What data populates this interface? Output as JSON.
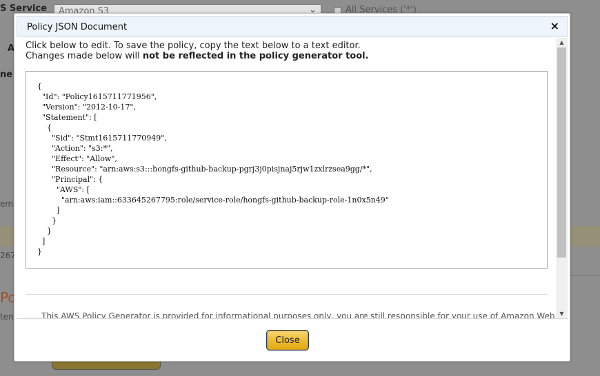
{
  "background": {
    "service_label": "S Service",
    "service_select_value": "Amazon S3",
    "all_services_label": "All Services ('*')",
    "label_a": "A",
    "label_ne": "ne",
    "label_em": "em",
    "label_267": "267",
    "label_pol": "Pol",
    "label_ten": "ten"
  },
  "dialog": {
    "title": "Policy JSON Document",
    "close_icon": "×",
    "intro_line1": "Click below to edit. To save the policy, copy the text below to a text editor.",
    "intro_line2_prefix": "Changes made below will ",
    "intro_line2_bold": "not be reflected in the policy generator tool.",
    "policy_json": "{\n  \"Id\": \"Policy1615711771956\",\n  \"Version\": \"2012-10-17\",\n  \"Statement\": [\n    {\n      \"Sid\": \"Stmt1615711770949\",\n      \"Action\": \"s3:*\",\n      \"Effect\": \"Allow\",\n      \"Resource\": \"arn:aws:s3:::hongfs-github-backup-pgrj3j0pisjnaj5rjw1zxlrzsea9gg/*\",\n      \"Principal\": {\n        \"AWS\": [\n          \"arn:aws:iam::633645267795:role/service-role/hongfs-github-backup-role-1n0x5n49\"\n        ]\n      }\n    }\n  ]\n}",
    "disclaimer": "This AWS Policy Generator is provided for informational purposes only, you are still responsible for your use of Amazon Web Services",
    "close_button_label": "Close"
  },
  "icons": {
    "close": "close-icon",
    "scroll_up": "scroll-up-icon",
    "scroll_down": "scroll-down-icon",
    "select_chevron": "chevron-down-icon"
  },
  "colors": {
    "title_bar": "#eef4fc",
    "close_button": "#eeb930",
    "overlay": "#8e8e8e"
  }
}
